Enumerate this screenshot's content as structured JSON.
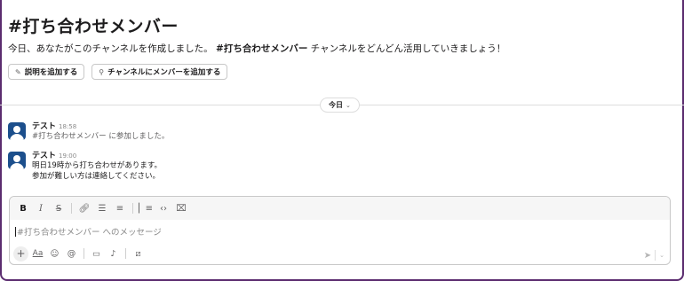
{
  "channel": {
    "title": "#打ち合わせメンバー",
    "intro_prefix": "今日、あなたがこのチャンネルを作成しました。",
    "intro_channel": "#打ち合わせメンバー",
    "intro_suffix": " チャンネルをどんどん活用していきましょう！",
    "add_description_label": "説明を追加する",
    "add_members_label": "チャンネルにメンバーを追加する"
  },
  "date_divider": {
    "label": "今日"
  },
  "messages": [
    {
      "author": "テスト",
      "time": "18:58",
      "lines": [
        "#打ち合わせメンバー に参加しました。"
      ]
    },
    {
      "author": "テスト",
      "time": "19:00",
      "lines": [
        "明日19時から打ち合わせがあります。",
        "参加が難しい方は連絡してください。"
      ]
    }
  ],
  "composer": {
    "placeholder": "#打ち合わせメンバー へのメッセージ",
    "aa_label": "Aa"
  },
  "colors": {
    "frame": "#5b2c6f",
    "avatar": "#1c4f8c",
    "text": "#1d1c1d",
    "muted": "#616061"
  }
}
